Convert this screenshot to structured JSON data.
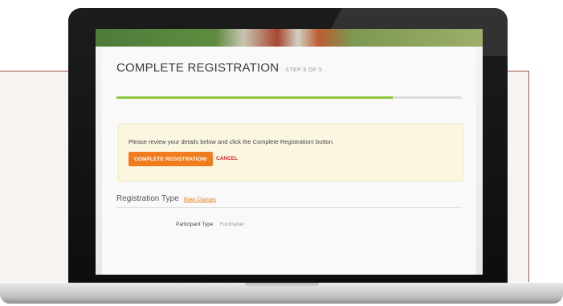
{
  "registration": {
    "title": "COMPLETE REGISTRATION",
    "step_label": "STEP 5 OF 5",
    "progress": 0.8
  },
  "notice": {
    "message": "Please review your details below and click the Complete Registration! button.",
    "complete_label": "COMPLETE REGISTRATION!",
    "cancel_label": "CANCEL"
  },
  "registration_type": {
    "heading": "Registration Type",
    "edit_label": "Make Changes",
    "participant_type_label": "Participant Type",
    "participant_type_value": "Fundraiser"
  },
  "colors": {
    "accent_orange": "#f07c1e",
    "progress_green": "#8cc63f",
    "cancel_red": "#d0242b",
    "notice_background": "#fbf6df"
  }
}
